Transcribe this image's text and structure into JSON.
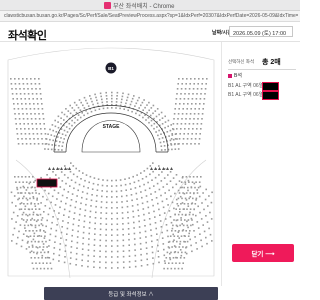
{
  "window": {
    "title": "부산 좌석배치 - Chrome",
    "address": "clawsticbusan.busan.go.kr/Pages/Sc/Perf/Sale/SeatPreviewProcess.aspx?sp=1&IdxPerf=20307&IdxPerfDate=2026-05-09&IdxTime=1404&TableIdx=..."
  },
  "page": {
    "title": "좌석확인",
    "date_label": "날짜/시간",
    "date_value": "2026.05.09 (토) 17:00"
  },
  "seatmap": {
    "badge": "B1",
    "stage_label": "STAGE",
    "colors": {
      "seat": "#9b9b9b",
      "selected": "#111111",
      "selected_border": "#e3104c",
      "stage_bg": "#ffffff",
      "badge_bg": "#1b1b2a"
    }
  },
  "panel": {
    "header_label": "선택하신 좌석",
    "header_count": "총 2매",
    "category": "B석",
    "rows": [
      {
        "text": "B1 AL 구역 06열"
      },
      {
        "text": "B1 AL 구역 06열"
      }
    ]
  },
  "actions": {
    "close_label": "닫기 ⟶",
    "bottom_label": "등급 및 좌석정보 ∧"
  }
}
